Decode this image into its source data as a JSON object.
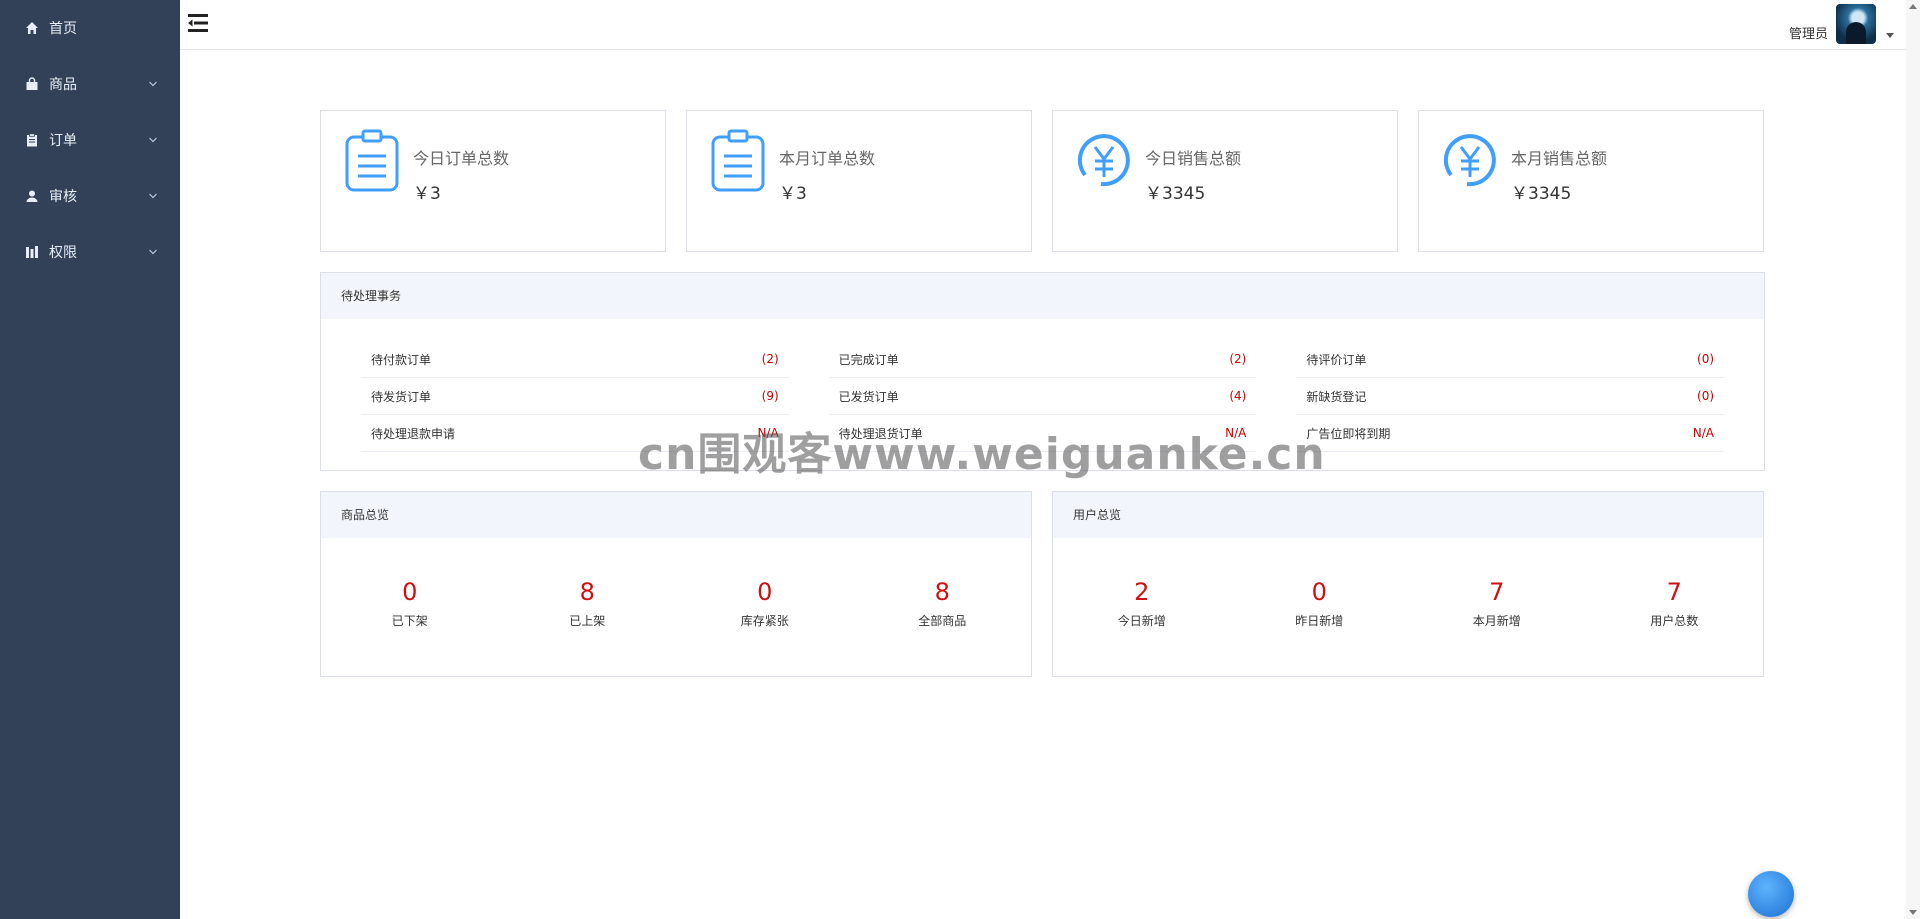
{
  "sidebar": {
    "items": [
      {
        "label": "首页",
        "icon": "home-icon"
      },
      {
        "label": "商品",
        "icon": "bag-icon"
      },
      {
        "label": "订单",
        "icon": "clipboard-icon"
      },
      {
        "label": "审核",
        "icon": "user-icon"
      },
      {
        "label": "权限",
        "icon": "bars-icon"
      }
    ]
  },
  "header": {
    "user_name": "管理员"
  },
  "stats": [
    {
      "label": "今日订单总数",
      "value": "￥3",
      "icon": "clipboard-icon"
    },
    {
      "label": "本月订单总数",
      "value": "￥3",
      "icon": "clipboard-icon"
    },
    {
      "label": "今日销售总额",
      "value": "￥3345",
      "icon": "yuan-icon"
    },
    {
      "label": "本月销售总额",
      "value": "￥3345",
      "icon": "yuan-icon"
    }
  ],
  "pending": {
    "title": "待处理事务",
    "columns": [
      [
        {
          "label": "待付款订单",
          "count": "(2)"
        },
        {
          "label": "待发货订单",
          "count": "(9)"
        },
        {
          "label": "待处理退款申请",
          "count": "N/A"
        }
      ],
      [
        {
          "label": "已完成订单",
          "count": "(2)"
        },
        {
          "label": "已发货订单",
          "count": "(4)"
        },
        {
          "label": "待处理退货订单",
          "count": "N/A"
        }
      ],
      [
        {
          "label": "待评价订单",
          "count": "(0)"
        },
        {
          "label": "新缺货登记",
          "count": "(0)"
        },
        {
          "label": "广告位即将到期",
          "count": "N/A"
        }
      ]
    ]
  },
  "product_overview": {
    "title": "商品总览",
    "items": [
      {
        "value": "0",
        "label": "已下架"
      },
      {
        "value": "8",
        "label": "已上架"
      },
      {
        "value": "0",
        "label": "库存紧张"
      },
      {
        "value": "8",
        "label": "全部商品"
      }
    ]
  },
  "user_overview": {
    "title": "用户总览",
    "items": [
      {
        "value": "2",
        "label": "今日新增"
      },
      {
        "value": "0",
        "label": "昨日新增"
      },
      {
        "value": "7",
        "label": "本月新增"
      },
      {
        "value": "7",
        "label": "用户总数"
      }
    ]
  },
  "watermark": "cn围观客www.weiguanke.cn",
  "colors": {
    "sidebar": "#324157",
    "accent": "#409eff",
    "count_red": "#cc0000",
    "summary_red": "#d10f0f"
  }
}
